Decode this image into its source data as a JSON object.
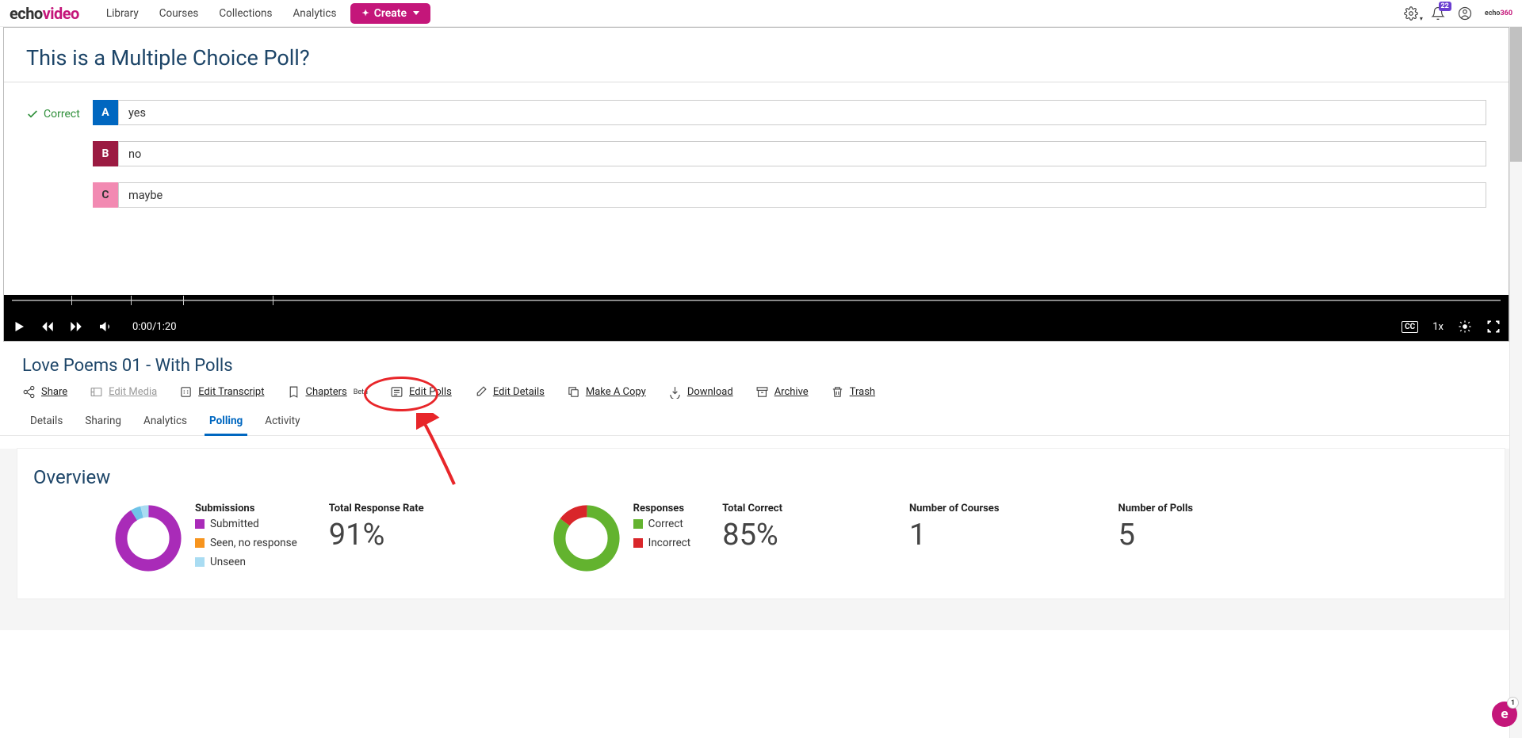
{
  "brand": {
    "part1": "echo",
    "part2": "video",
    "mini1": "echo",
    "mini2": "360"
  },
  "nav": {
    "library": "Library",
    "courses": "Courses",
    "collections": "Collections",
    "analytics": "Analytics"
  },
  "create_label": "Create",
  "notif_badge": "22",
  "poll": {
    "title": "This is a Multiple Choice Poll?",
    "correct_label": "Correct",
    "options": [
      {
        "letter": "A",
        "text": "yes"
      },
      {
        "letter": "B",
        "text": "no"
      },
      {
        "letter": "C",
        "text": "maybe"
      }
    ]
  },
  "player": {
    "timecode": "0:00/1:20",
    "speed": "1x",
    "cc": "CC"
  },
  "media_title": "Love Poems 01 - With Polls",
  "actions": {
    "share": "Share",
    "edit_media": "Edit Media",
    "edit_transcript": "Edit Transcript",
    "chapters": "Chapters",
    "chapters_sup": "Beta",
    "edit_polls": "Edit Polls",
    "edit_details": "Edit Details",
    "make_copy": "Make A Copy",
    "download": "Download",
    "archive": "Archive",
    "trash": "Trash"
  },
  "tabs": {
    "details": "Details",
    "sharing": "Sharing",
    "analytics": "Analytics",
    "polling": "Polling",
    "activity": "Activity"
  },
  "overview": {
    "title": "Overview",
    "submissions_label": "Submissions",
    "sub_legend": {
      "submitted": "Submitted",
      "seen": "Seen, no response",
      "unseen": "Unseen"
    },
    "response_rate_label": "Total Response Rate",
    "response_rate": "91%",
    "responses_label": "Responses",
    "resp_legend": {
      "correct": "Correct",
      "incorrect": "Incorrect"
    },
    "total_correct_label": "Total Correct",
    "total_correct": "85%",
    "num_courses_label": "Number of Courses",
    "num_courses": "1",
    "num_polls_label": "Number of Polls",
    "num_polls": "5"
  },
  "colors": {
    "submitted": "#a92bb8",
    "seen": "#6fc3e8",
    "unseen": "#a9dcf2",
    "correct": "#63b32f",
    "incorrect": "#d9262a"
  },
  "float_badge": "1",
  "chart_data": [
    {
      "type": "pie",
      "title": "Submissions",
      "series": [
        {
          "name": "Submitted",
          "value": 91
        },
        {
          "name": "Seen, no response",
          "value": 5
        },
        {
          "name": "Unseen",
          "value": 4
        }
      ]
    },
    {
      "type": "pie",
      "title": "Responses",
      "series": [
        {
          "name": "Correct",
          "value": 85
        },
        {
          "name": "Incorrect",
          "value": 15
        }
      ]
    }
  ]
}
